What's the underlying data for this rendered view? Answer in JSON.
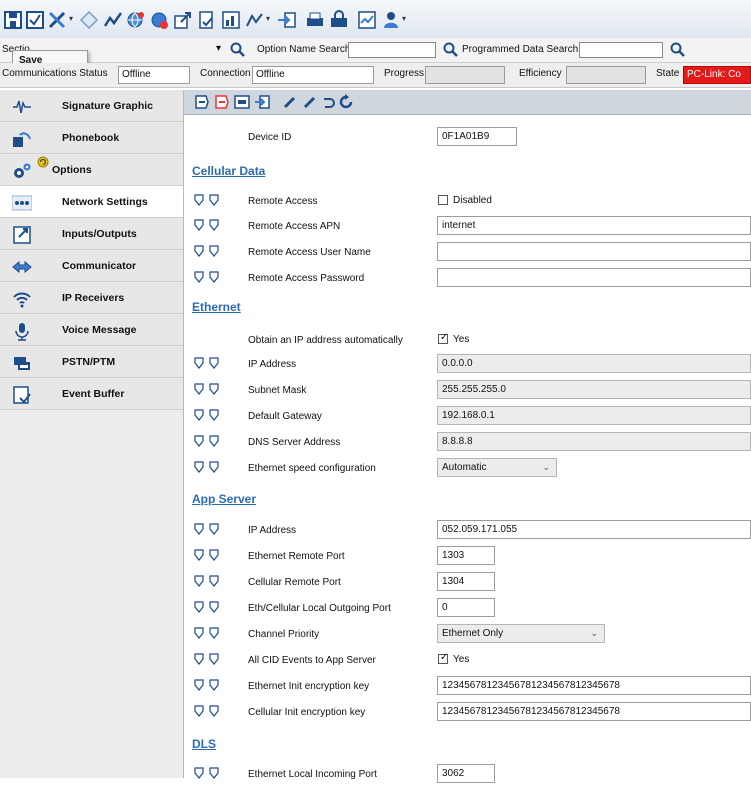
{
  "popup": {
    "label": "Save"
  },
  "search": {
    "section_label": "Sectio",
    "option_name_label": "Option Name Search",
    "programmed_label": "Programmed Data Search",
    "option_value": "",
    "programmed_value": ""
  },
  "status": {
    "comm_label": "Communications Status",
    "comm_value": "Offline",
    "conn_label": "Connection",
    "conn_value": "Offline",
    "progress_label": "Progress",
    "efficiency_label": "Efficiency",
    "state_label": "State",
    "state_value": "PC-Link: Co"
  },
  "sidebar": {
    "items": [
      {
        "label": "Signature Graphic",
        "icon": "signature-icon"
      },
      {
        "label": "Phonebook",
        "icon": "phonebook-icon"
      },
      {
        "label": "Options",
        "icon": "options-gears-icon"
      },
      {
        "label": "Network Settings",
        "icon": "network-dots-icon"
      },
      {
        "label": "Inputs/Outputs",
        "icon": "inputs-outputs-icon"
      },
      {
        "label": "Communicator",
        "icon": "communicator-icon"
      },
      {
        "label": "IP Receivers",
        "icon": "wifi-icon"
      },
      {
        "label": "Voice Message",
        "icon": "microphone-icon"
      },
      {
        "label": "PSTN/PTM",
        "icon": "pstn-icon"
      },
      {
        "label": "Event Buffer",
        "icon": "event-buffer-icon"
      }
    ]
  },
  "content": {
    "device_id_label": "Device ID",
    "device_id_value": "0F1A01B9",
    "sections": {
      "cellular": "Cellular Data",
      "ethernet": "Ethernet",
      "app_server": "App Server",
      "dls": "DLS"
    },
    "cellular": {
      "remote_access_label": "Remote Access",
      "remote_access_value": "Disabled",
      "apn_label": "Remote Access APN",
      "apn_value": "internet",
      "user_label": "Remote Access User Name",
      "user_value": "",
      "password_label": "Remote Access Password",
      "password_value": ""
    },
    "ethernet": {
      "dhcp_label": "Obtain an IP address automatically",
      "dhcp_value": "Yes",
      "ip_label": "IP Address",
      "ip_value": "0.0.0.0",
      "subnet_label": "Subnet Mask",
      "subnet_value": "255.255.255.0",
      "gateway_label": "Default Gateway",
      "gateway_value": "192.168.0.1",
      "dns_label": "DNS Server Address",
      "dns_value": "8.8.8.8",
      "speed_label": "Ethernet speed configuration",
      "speed_value": "Automatic"
    },
    "app_server": {
      "ip_label": "IP Address",
      "ip_value": "052.059.171.055",
      "eth_port_label": "Ethernet Remote Port",
      "eth_port_value": "1303",
      "cell_port_label": "Cellular Remote Port",
      "cell_port_value": "1304",
      "local_port_label": "Eth/Cellular Local Outgoing Port",
      "local_port_value": "0",
      "priority_label": "Channel Priority",
      "priority_value": "Ethernet Only",
      "cid_label": "All CID Events to App Server",
      "cid_value": "Yes",
      "eth_key_label": "Ethernet Init encryption key",
      "eth_key_value": "12345678123456781234567812345678",
      "cell_key_label": "Cellular Init encryption key",
      "cell_key_value": "12345678123456781234567812345678"
    },
    "dls": {
      "eth_local_label": "Ethernet Local Incoming Port",
      "eth_local_value": "3062"
    }
  }
}
